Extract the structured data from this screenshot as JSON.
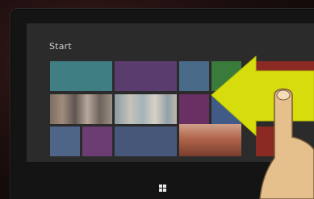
{
  "start_screen": {
    "title": "Start"
  },
  "gesture": {
    "description_icon": "swipe-left-from-right-edge",
    "arrow_color": "#d7dc0c",
    "hand_color": "#e6c08c"
  },
  "colors": {
    "screen_bg": "#2b2b2b",
    "tile_teal": "#3f7f83",
    "tile_purple": "#5a3d6e",
    "tile_blue": "#4a6a8a",
    "tile_green": "#3a7a3a",
    "tile_magenta": "#6a2f63",
    "tile_slate": "#47577a",
    "tile_red": "#8a2a22"
  },
  "taskbar": {
    "windows_button_icon": "windows-logo-icon"
  }
}
